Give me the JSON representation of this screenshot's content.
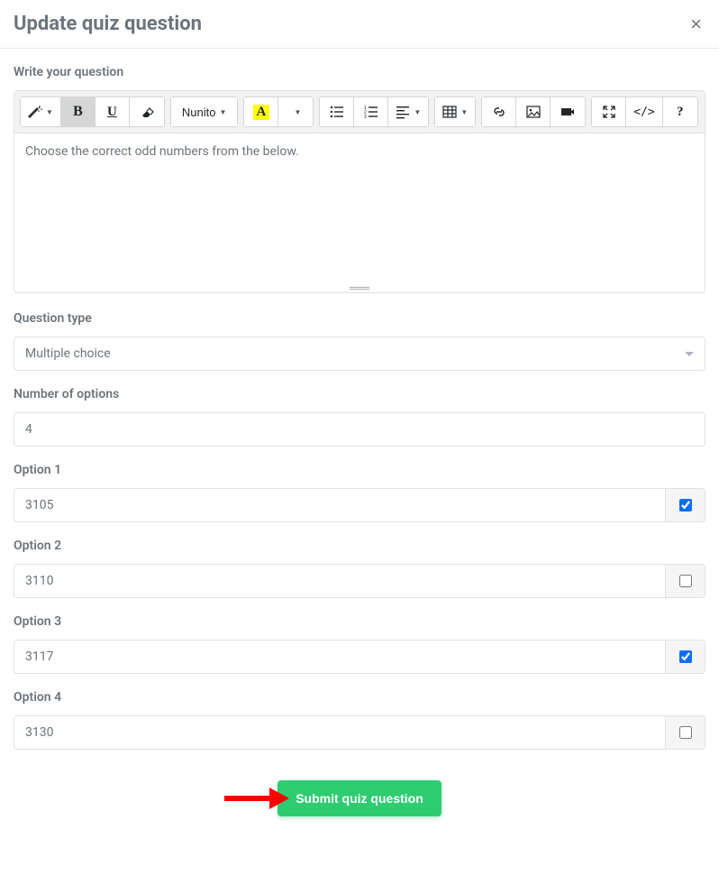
{
  "header": {
    "title": "Update quiz question",
    "close": "×"
  },
  "editor": {
    "label": "Write your question",
    "font_family": "Nunito",
    "content": "Choose the correct odd numbers from the below.",
    "toolbar": {
      "bold": "B",
      "underline": "U",
      "highlight": "A",
      "code": "</>",
      "help": "?"
    }
  },
  "question_type": {
    "label": "Question type",
    "value": "Multiple choice"
  },
  "num_options": {
    "label": "Number of options",
    "value": "4"
  },
  "options": [
    {
      "label": "Option 1",
      "value": "3105",
      "checked": true
    },
    {
      "label": "Option 2",
      "value": "3110",
      "checked": false
    },
    {
      "label": "Option 3",
      "value": "3117",
      "checked": true
    },
    {
      "label": "Option 4",
      "value": "3130",
      "checked": false
    }
  ],
  "submit": {
    "label": "Submit quiz question"
  }
}
